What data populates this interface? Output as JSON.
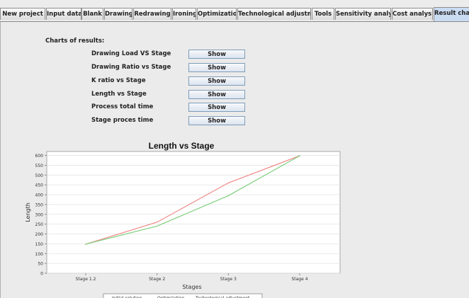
{
  "tabs": [
    {
      "label": "New project"
    },
    {
      "label": "Input data"
    },
    {
      "label": "Blank"
    },
    {
      "label": "Drawing"
    },
    {
      "label": "Redrawing"
    },
    {
      "label": "Ironing"
    },
    {
      "label": "Optimization"
    },
    {
      "label": "Technological adjustment"
    },
    {
      "label": "Tools"
    },
    {
      "label": "Sensitivity analysis"
    },
    {
      "label": "Cost analysis"
    },
    {
      "label": "Result charts",
      "active": true
    }
  ],
  "charts_panel": {
    "title": "Charts of results:",
    "rows": [
      {
        "label": "Drawing Load VS Stage",
        "button": "Show"
      },
      {
        "label": "Drawing Ratio vs Stage",
        "button": "Show"
      },
      {
        "label": "K ratio vs Stage",
        "button": "Show"
      },
      {
        "label": "Length vs Stage",
        "button": "Show"
      },
      {
        "label": "Process total time",
        "button": "Show"
      },
      {
        "label": "Stage proces time",
        "button": "Show"
      }
    ]
  },
  "chart_data": {
    "type": "line",
    "title": "Length vs Stage",
    "xlabel": "Stages",
    "ylabel": "Length",
    "categories": [
      "Stage 1.2",
      "Stage 2",
      "Stage 3",
      "Stage 4"
    ],
    "ylim": [
      0,
      620
    ],
    "yticks": [
      0,
      50,
      100,
      150,
      200,
      250,
      300,
      350,
      400,
      450,
      500,
      550,
      600
    ],
    "grid": true,
    "series": [
      {
        "values": [
          148,
          260,
          460,
          598
        ],
        "color": "#f08a8a"
      },
      {
        "values": [
          148,
          240,
          395,
          598
        ],
        "color": "#7fcf7f"
      }
    ],
    "legend_partial": [
      "Initial solution",
      "Optimization",
      "Technological adjustment"
    ]
  }
}
